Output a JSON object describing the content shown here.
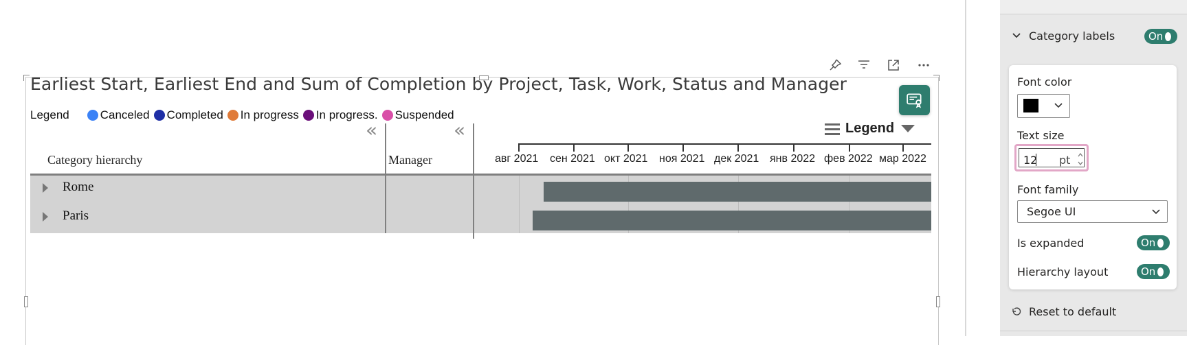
{
  "visual": {
    "title": "Earliest Start, Earliest End and Sum of Completion by Project, Task, Work, Status and Manager",
    "toolbar": [
      "pin-icon",
      "filter-icon",
      "focus-mode-icon",
      "more-options-icon"
    ],
    "legend": {
      "title": "Legend",
      "items": [
        {
          "label": "Canceled",
          "color": "#3b82f6"
        },
        {
          "label": "Completed",
          "color": "#1f2fa6"
        },
        {
          "label": "In progress",
          "color": "#e07b39"
        },
        {
          "label": "In progress.",
          "color": "#6b0f7a"
        },
        {
          "label": "Suspended",
          "color": "#d94fa8"
        }
      ]
    },
    "legend_control_label": "Legend",
    "collapse_glyph": "«",
    "headers": {
      "category": "Category hierarchy",
      "manager": "Manager"
    },
    "timeline": [
      "авг 2021",
      "сен 2021",
      "окт 2021",
      "ноя 2021",
      "дек 2021",
      "янв 2022",
      "фев 2022",
      "мар 2022"
    ],
    "rows": [
      {
        "label": "Rome"
      },
      {
        "label": "Paris"
      }
    ],
    "bar_color": "#5f6a6c",
    "accent": "#2e7d6e"
  },
  "pane": {
    "section": {
      "title": "Category labels",
      "toggle": "On"
    },
    "font_color": {
      "label": "Font color",
      "value": "#000000"
    },
    "text_size": {
      "label": "Text size",
      "value": "12",
      "unit": "pt"
    },
    "font_family": {
      "label": "Font family",
      "value": "Segoe UI"
    },
    "is_expanded": {
      "label": "Is expanded",
      "toggle": "On"
    },
    "hierarchy_layout": {
      "label": "Hierarchy layout",
      "toggle": "On"
    },
    "reset_label": "Reset to default"
  }
}
